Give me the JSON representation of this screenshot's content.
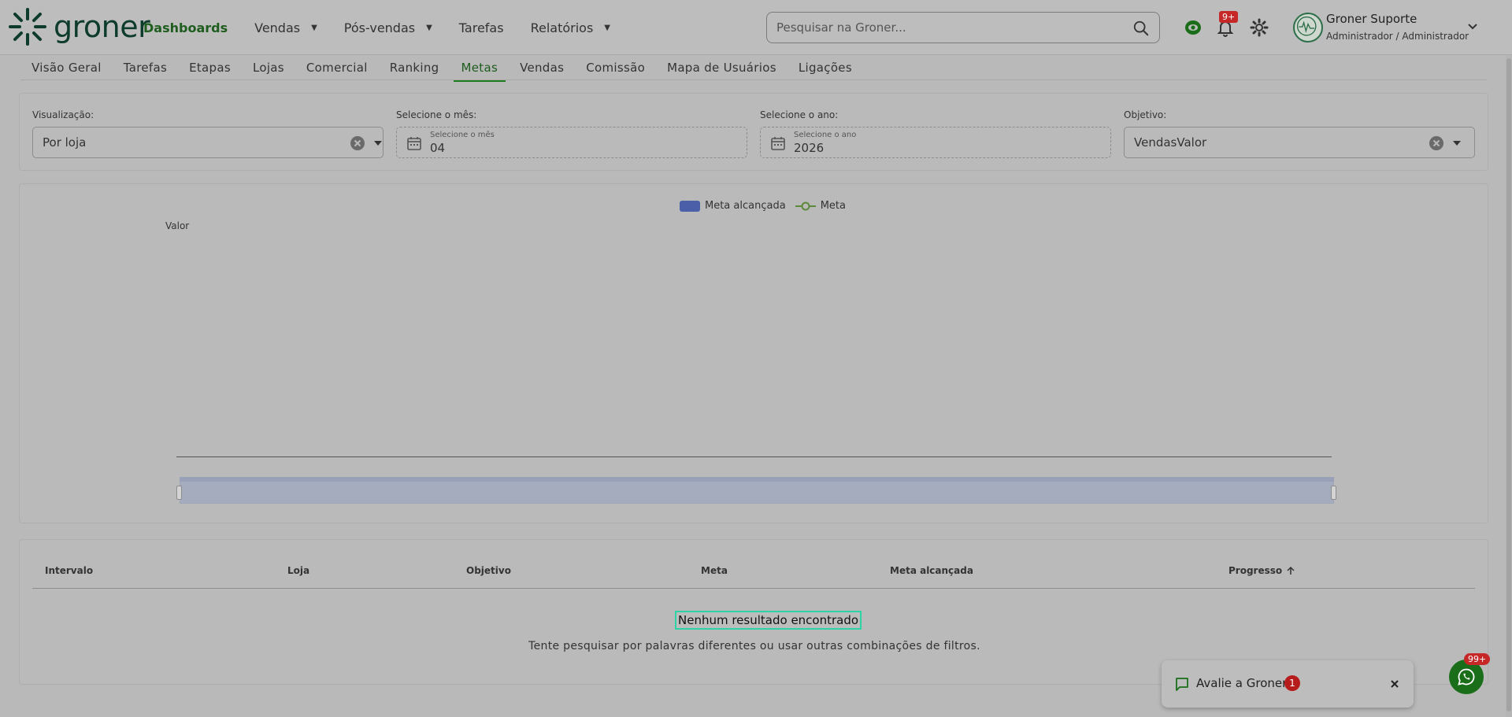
{
  "brand": {
    "name": "groner"
  },
  "nav": {
    "items": [
      {
        "label": "Dashboards",
        "active": true,
        "has_caret": false
      },
      {
        "label": "Vendas",
        "has_caret": true
      },
      {
        "label": "Pós-vendas",
        "has_caret": true
      },
      {
        "label": "Tarefas",
        "has_caret": false
      },
      {
        "label": "Relatórios",
        "has_caret": true
      }
    ]
  },
  "search": {
    "placeholder": "Pesquisar na Groner..."
  },
  "notifications": {
    "badge": "9+"
  },
  "user": {
    "name": "Groner Suporte",
    "role": "Administrador / Administrador"
  },
  "subtabs": [
    "Visão Geral",
    "Tarefas",
    "Etapas",
    "Lojas",
    "Comercial",
    "Ranking",
    "Metas",
    "Vendas",
    "Comissão",
    "Mapa de Usuários",
    "Ligações"
  ],
  "active_subtab": "Metas",
  "filters": {
    "visualizacao": {
      "label": "Visualização:",
      "value": "Por loja"
    },
    "mes": {
      "label": "Selecione o mês:",
      "hint": "Selecione o mês",
      "value": "04"
    },
    "ano": {
      "label": "Selecione o ano:",
      "hint": "Selecione o ano",
      "value": "2026"
    },
    "objetivo": {
      "label": "Objetivo:",
      "value": "VendasValor"
    }
  },
  "chart_data": {
    "type": "bar",
    "legend": [
      "Meta alcançada",
      "Meta"
    ],
    "legend_position": "top-center",
    "ylabel": "Valor",
    "categories": [],
    "series": [
      {
        "name": "Meta alcançada",
        "values": [],
        "color": "#4b5fa8"
      },
      {
        "name": "Meta",
        "values": [],
        "color": "#5a8a3a"
      }
    ]
  },
  "table": {
    "columns": [
      "Intervalo",
      "Loja",
      "Objetivo",
      "Meta",
      "Meta alcançada",
      "Progresso"
    ],
    "sort_column": "Progresso",
    "empty_title": "Nenhum resultado encontrado",
    "empty_subtitle": "Tente pesquisar por palavras diferentes ou usar outras combinações de filtros."
  },
  "toast": {
    "text": "Avalie a Groner!",
    "badge": "1"
  },
  "whatsapp": {
    "badge": "99+"
  },
  "colors": {
    "brand_green": "#1e5d1e",
    "accent_teal": "#2ed3a5",
    "badge_red": "#c62828"
  }
}
